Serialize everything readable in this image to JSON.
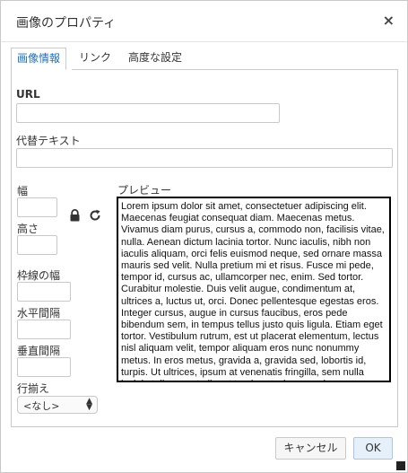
{
  "dialog": {
    "title": "画像のプロパティ",
    "close_glyph": "×"
  },
  "tabs": [
    {
      "label": "画像情報",
      "active": true
    },
    {
      "label": "リンク",
      "active": false
    },
    {
      "label": "高度な設定",
      "active": false
    }
  ],
  "fields": {
    "url_label": "URL",
    "url_value": "",
    "alt_label": "代替テキスト",
    "alt_value": "",
    "width_label": "幅",
    "width_value": "",
    "height_label": "高さ",
    "height_value": "",
    "border_label": "枠線の幅",
    "border_value": "",
    "hspace_label": "水平間隔",
    "hspace_value": "",
    "vspace_label": "垂直間隔",
    "vspace_value": "",
    "align_label": "行揃え",
    "align_value": "<なし>"
  },
  "preview": {
    "label": "プレビュー",
    "text": "Lorem ipsum dolor sit amet, consectetuer adipiscing elit. Maecenas feugiat consequat diam. Maecenas metus. Vivamus diam purus, cursus a, commodo non, facilisis vitae, nulla. Aenean dictum lacinia tortor. Nunc iaculis, nibh non iaculis aliquam, orci felis euismod neque, sed ornare massa mauris sed velit. Nulla pretium mi et risus. Fusce mi pede, tempor id, cursus ac, ullamcorper nec, enim. Sed tortor. Curabitur molestie. Duis velit augue, condimentum at, ultrices a, luctus ut, orci. Donec pellentesque egestas eros. Integer cursus, augue in cursus faucibus, eros pede bibendum sem, in tempus tellus justo quis ligula. Etiam eget tortor. Vestibulum rutrum, est ut placerat elementum, lectus nisl aliquam velit, tempor aliquam eros nunc nonummy metus. In eros metus, gravida a, gravida sed, lobortis id, turpis. Ut ultrices, ipsum at venenatis fringilla, sem nulla lacinia tellus, eget aliquet turpis mauris non enim."
  },
  "icons": {
    "lock": "lock-icon",
    "reset": "reset-size-icon"
  },
  "buttons": {
    "cancel": "キャンセル",
    "ok": "OK"
  },
  "colors": {
    "accent": "#1f6fb2",
    "ok_bg": "#e6f0fb"
  }
}
